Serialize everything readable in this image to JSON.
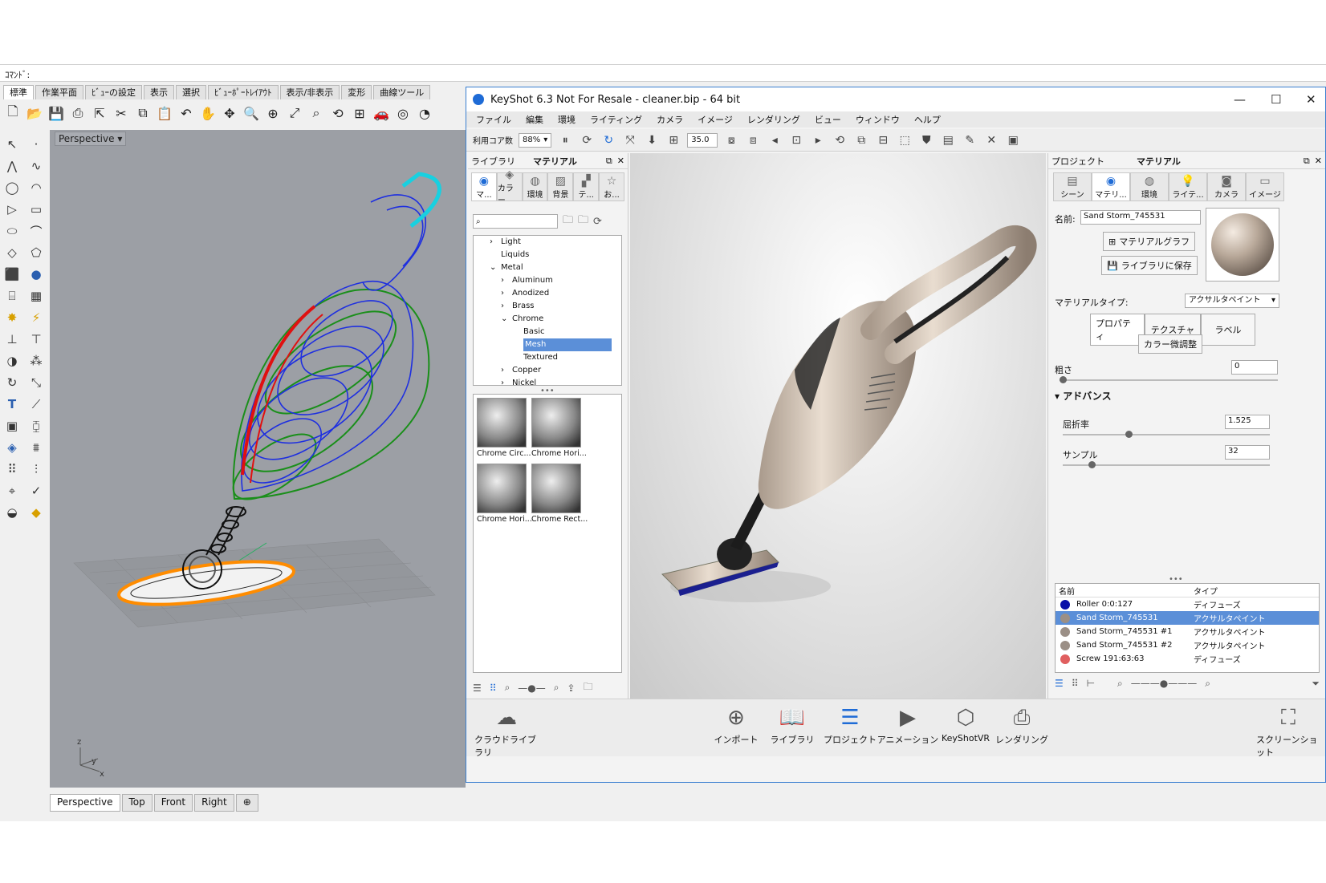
{
  "rhino": {
    "command_label": "ｺﾏﾝﾄﾞ:",
    "tabs": [
      "標準",
      "作業平面",
      "ﾋﾞｭｰの設定",
      "表示",
      "選択",
      "ﾋﾞｭｰﾎﾟｰﾄﾚｲｱｳﾄ",
      "表示/非表示",
      "変形",
      "曲線ツール"
    ],
    "viewport_label": "Perspective",
    "viewport_tabs": [
      "Perspective",
      "Top",
      "Front",
      "Right"
    ],
    "add_tab": "⊕",
    "axis": {
      "z": "z",
      "y": "y",
      "x": "x"
    }
  },
  "keyshot": {
    "title": "KeyShot 6.3 Not For Resale  - cleaner.bip - 64 bit",
    "menu": [
      "ファイル",
      "編集",
      "環境",
      "ライティング",
      "カメラ",
      "イメージ",
      "レンダリング",
      "ビュー",
      "ウィンドウ",
      "ヘルプ"
    ],
    "toolbar": {
      "cores_label": "利用コア数",
      "cores_value": "88%",
      "fov_value": "35.0"
    },
    "library": {
      "header_left": "ライブラリ",
      "header_title": "マテリアル",
      "tabs": [
        {
          "label": "マ...",
          "icon": "material-icon"
        },
        {
          "label": "カラー",
          "icon": "color-icon"
        },
        {
          "label": "環境",
          "icon": "environment-icon"
        },
        {
          "label": "背景",
          "icon": "background-icon"
        },
        {
          "label": "テ...",
          "icon": "texture-icon"
        },
        {
          "label": "お...",
          "icon": "favorites-icon"
        }
      ],
      "tree": [
        {
          "label": "Light",
          "indent": 1,
          "arrow": "›"
        },
        {
          "label": "Liquids",
          "indent": 1,
          "arrow": ""
        },
        {
          "label": "Metal",
          "indent": 1,
          "arrow": "⌄"
        },
        {
          "label": "Aluminum",
          "indent": 2,
          "arrow": "›"
        },
        {
          "label": "Anodized",
          "indent": 2,
          "arrow": "›"
        },
        {
          "label": "Brass",
          "indent": 2,
          "arrow": "›"
        },
        {
          "label": "Chrome",
          "indent": 2,
          "arrow": "⌄"
        },
        {
          "label": "Basic",
          "indent": 3,
          "arrow": ""
        },
        {
          "label": "Mesh",
          "indent": 3,
          "arrow": "",
          "selected": true
        },
        {
          "label": "Textured",
          "indent": 3,
          "arrow": ""
        },
        {
          "label": "Copper",
          "indent": 2,
          "arrow": "›"
        },
        {
          "label": "Nickel",
          "indent": 2,
          "arrow": "›"
        }
      ],
      "thumbnails": [
        "Chrome Circ...",
        "Chrome Hori...",
        "Chrome Hori...",
        "Chrome Rect..."
      ]
    },
    "project": {
      "header_left": "プロジェクト",
      "header_title": "マテリアル",
      "tabs": [
        {
          "label": "シーン",
          "icon": "scene-icon"
        },
        {
          "label": "マテリ...",
          "icon": "material-icon"
        },
        {
          "label": "環境",
          "icon": "environment-icon"
        },
        {
          "label": "ライテ...",
          "icon": "lighting-icon"
        },
        {
          "label": "カメラ",
          "icon": "camera-icon"
        },
        {
          "label": "イメージ",
          "icon": "image-icon"
        }
      ],
      "name_label": "名前:",
      "name_value": "Sand Storm_745531",
      "graph_button": "マテリアルグラフ",
      "save_button": "ライブラリに保存",
      "type_label": "マテリアルタイプ:",
      "type_value": "アクサルタペイント",
      "subtabs": [
        "プロパティ",
        "テクスチャ",
        "ラベル"
      ],
      "color_adjust": "カラー微調整",
      "roughness_label": "粗さ",
      "roughness_value": "0",
      "advanced_label": "アドバンス",
      "ior_label": "屈折率",
      "ior_value": "1.525",
      "samples_label": "サンプル",
      "samples_value": "32",
      "list_headers": {
        "name": "名前",
        "type": "タイプ"
      },
      "materials": [
        {
          "name": "Roller 0:0:127",
          "type": "ディフューズ",
          "color": "#0a10a8"
        },
        {
          "name": "Sand Storm_745531",
          "type": "アクサルタペイント",
          "color": "#9b8f86",
          "selected": true
        },
        {
          "name": "Sand Storm_745531 #1",
          "type": "アクサルタペイント",
          "color": "#9b8f86"
        },
        {
          "name": "Sand Storm_745531 #2",
          "type": "アクサルタペイント",
          "color": "#9b8f86"
        },
        {
          "name": "Screw 191:63:63",
          "type": "ディフューズ",
          "color": "#e05f5f"
        }
      ]
    },
    "bottom": [
      {
        "label": "クラウドライブラリ",
        "icon": "cloud-library-icon"
      },
      {
        "label": "インポート",
        "icon": "import-icon"
      },
      {
        "label": "ライブラリ",
        "icon": "library-icon"
      },
      {
        "label": "プロジェクト",
        "icon": "project-icon"
      },
      {
        "label": "アニメーション",
        "icon": "animation-icon"
      },
      {
        "label": "KeyShotVR",
        "icon": "keyshotvr-icon"
      },
      {
        "label": "レンダリング",
        "icon": "render-icon"
      },
      {
        "label": "スクリーンショット",
        "icon": "screenshot-icon"
      }
    ]
  }
}
